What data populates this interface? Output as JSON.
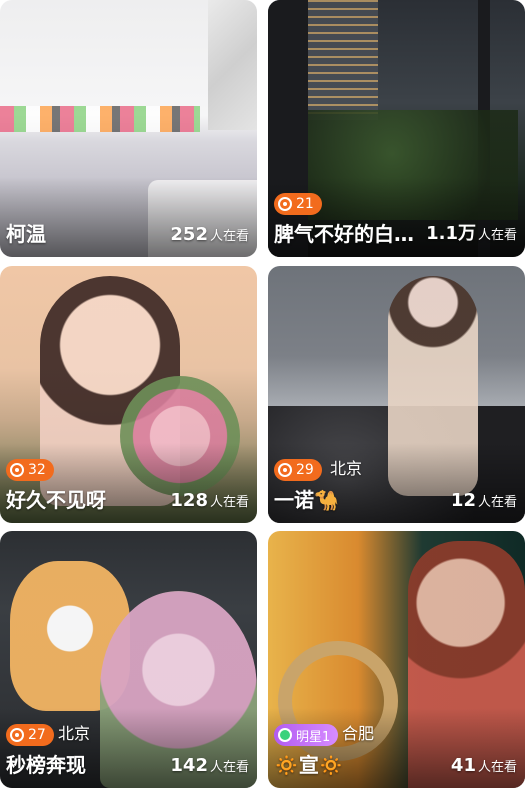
{
  "cards": [
    {
      "title": "柯温",
      "views": "252",
      "views_unit": "人在看",
      "badge": "",
      "city": ""
    },
    {
      "title": "脾气不好的白…",
      "views": "1.1万",
      "views_unit": "人在看",
      "badge": "21",
      "city": ""
    },
    {
      "title": "好久不见呀",
      "views": "128",
      "views_unit": "人在看",
      "badge": "32",
      "city": ""
    },
    {
      "title": "一诺🐪",
      "views": "12",
      "views_unit": "人在看",
      "badge": "29",
      "city": "北京"
    },
    {
      "title": "秒榜奔现",
      "views": "142",
      "views_unit": "人在看",
      "badge": "27",
      "city": "北京"
    },
    {
      "title": "🔅宣🔅",
      "views": "41",
      "views_unit": "人在看",
      "badge": "明星1",
      "city": "合肥"
    }
  ],
  "colors": {
    "badge_orange": "#f26b1d",
    "badge_purple": "#b25cf2"
  },
  "icons": [
    "hot-ring-icon",
    "star-level-icon"
  ]
}
